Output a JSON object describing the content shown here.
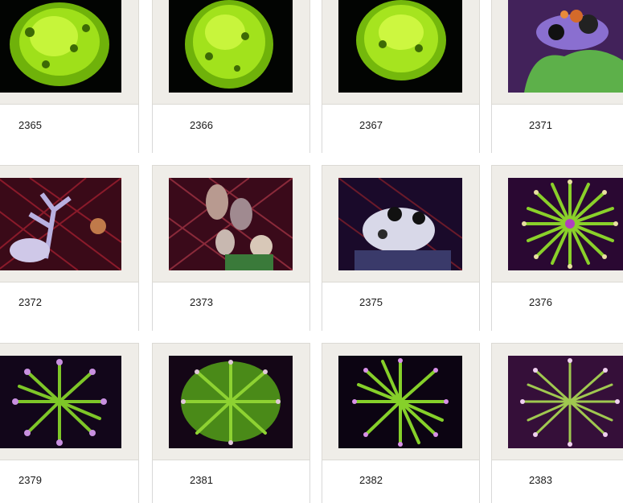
{
  "gallery": {
    "items": [
      {
        "id": "2365",
        "subject": "green-coral"
      },
      {
        "id": "2366",
        "subject": "green-coral"
      },
      {
        "id": "2367",
        "subject": "green-coral"
      },
      {
        "id": "2371",
        "subject": "sea-squirts"
      },
      {
        "id": "2372",
        "subject": "sea-squirts-branch"
      },
      {
        "id": "2373",
        "subject": "sea-squirts"
      },
      {
        "id": "2375",
        "subject": "sea-squirts"
      },
      {
        "id": "2376",
        "subject": "torch-coral"
      },
      {
        "id": "2379",
        "subject": "torch-coral"
      },
      {
        "id": "2381",
        "subject": "torch-coral"
      },
      {
        "id": "2382",
        "subject": "torch-coral"
      },
      {
        "id": "2383",
        "subject": "torch-coral"
      }
    ]
  },
  "colors": {
    "frame": "#efede8",
    "caption_text": "#1a1a1a"
  }
}
